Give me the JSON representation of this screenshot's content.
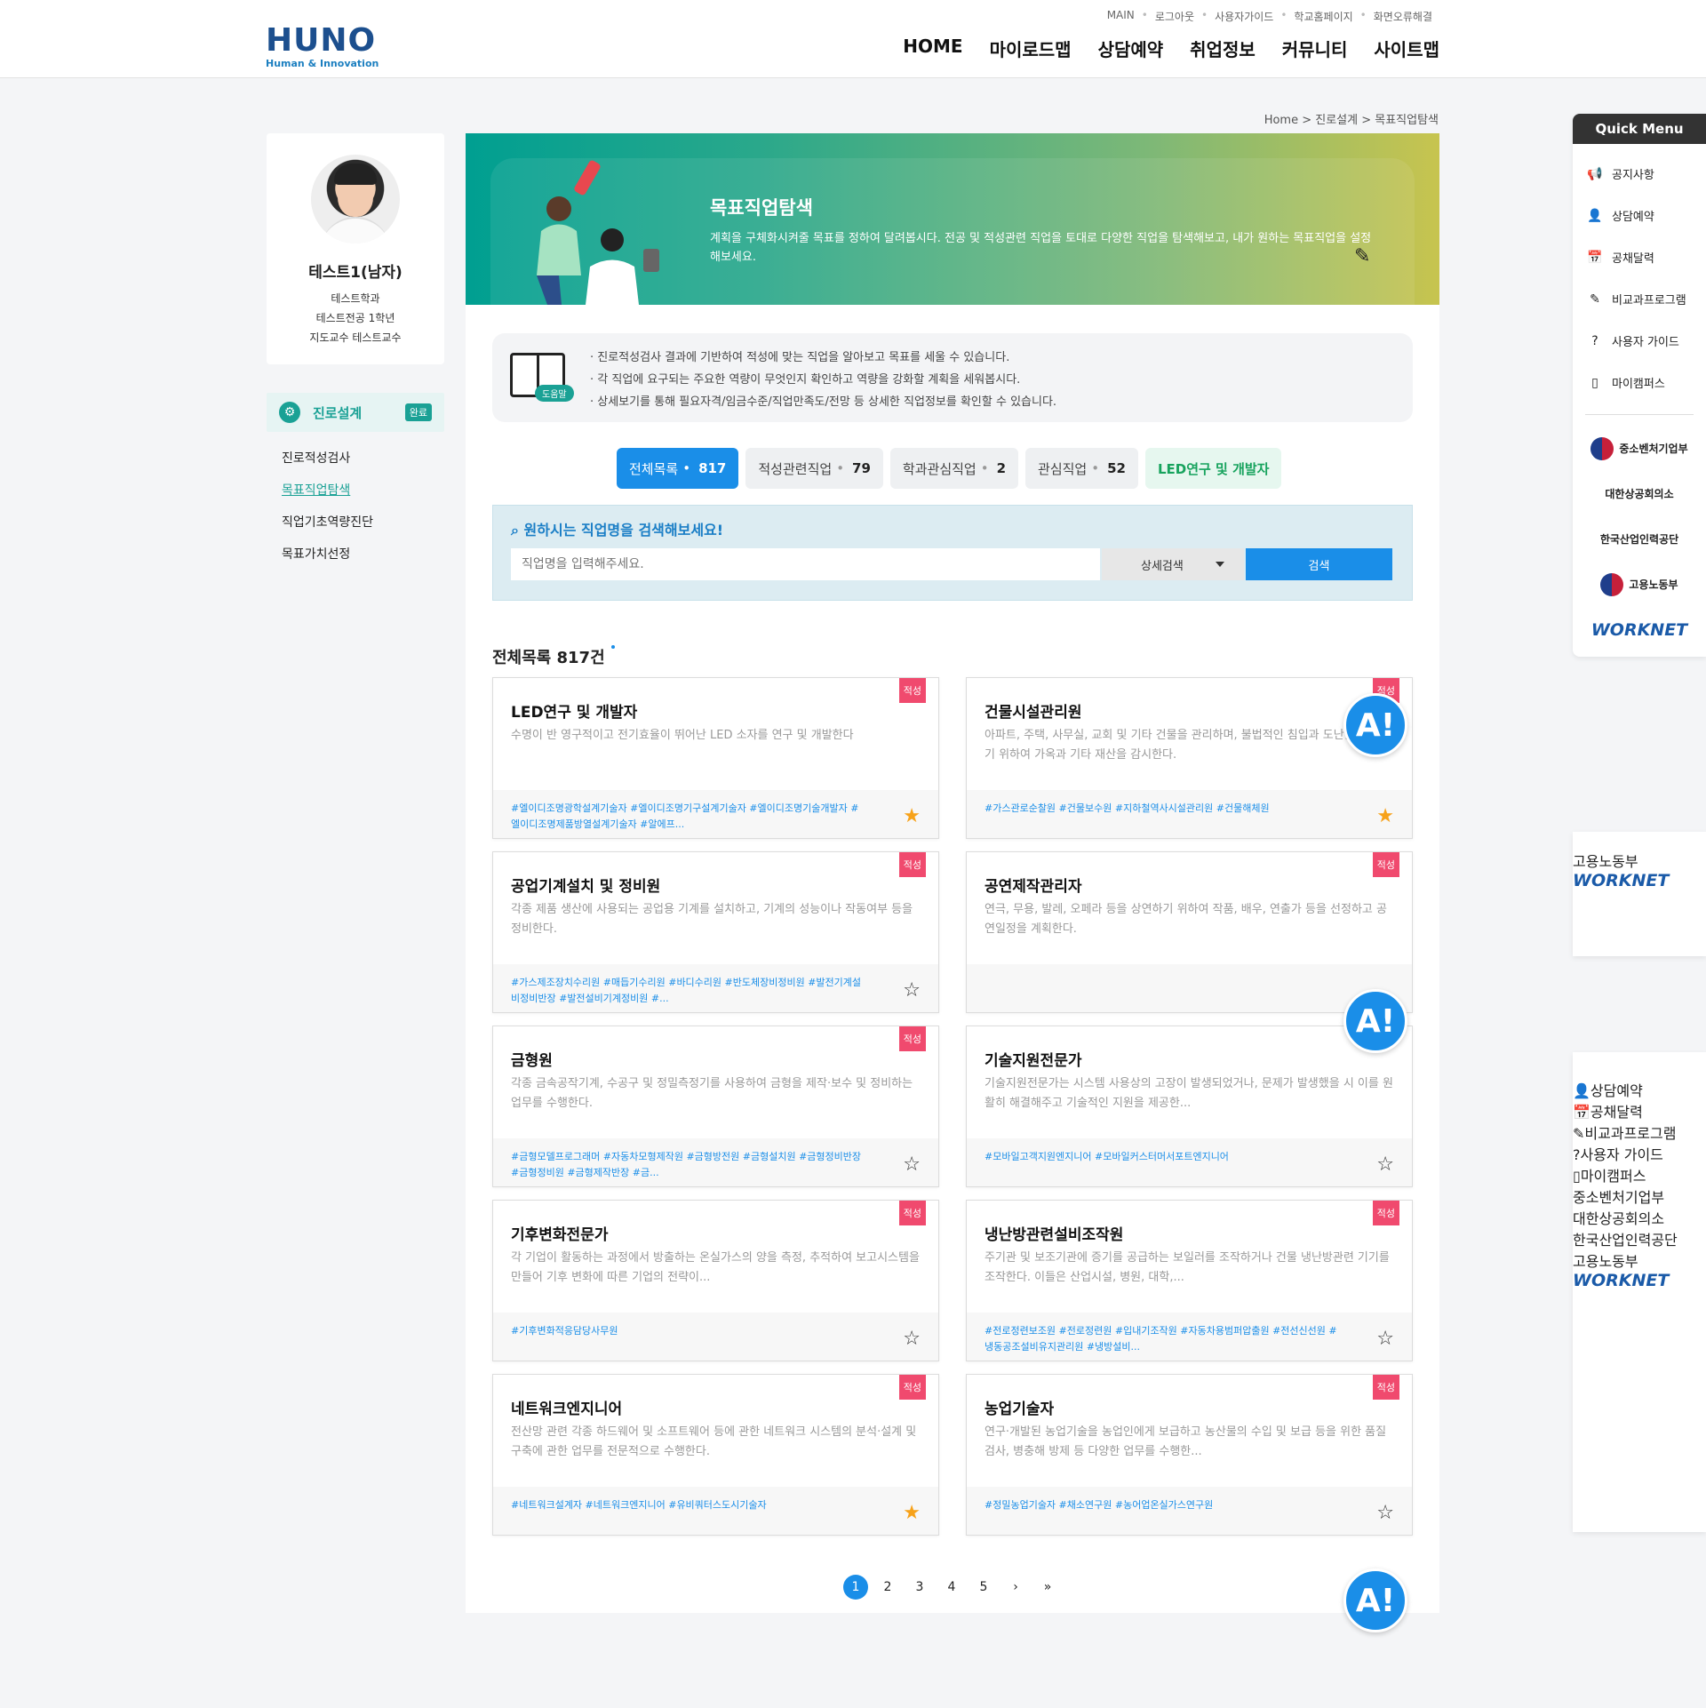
{
  "header": {
    "logo_main": "HUNO",
    "logo_sub": "Human & Innovation",
    "util": [
      "MAIN",
      "로그아웃",
      "사용자가이드",
      "학교홈페이지",
      "화면오류해결"
    ],
    "gnb": [
      "HOME",
      "마이로드맵",
      "상담예약",
      "취업정보",
      "커뮤니티",
      "사이트맵"
    ]
  },
  "breadcrumb": "Home > 진로설계 > 목표직업탐색",
  "profile": {
    "name": "테스트1(남자)",
    "dept": "테스트학과",
    "major": "테스트전공 1학년",
    "advisor": "지도교수 테스트교수"
  },
  "left_menu": {
    "current": "진로설계",
    "badge": "완료",
    "items": [
      "진로적성검사",
      "목표직업탐색",
      "직업기초역량진단",
      "목표가치선정"
    ]
  },
  "hero": {
    "title": "목표직업탐색",
    "desc": "계획을 구체화시켜줄 목표를 정하여 달려봅시다. 전공 및 적성관련 직업을 토대로 다양한 직업을 탐색해보고, 내가 원하는 목표직업을 설정해보세요."
  },
  "guide": {
    "help_label": "도움말",
    "items": [
      "· 진로적성검사 결과에 기반하여 적성에 맞는 직업을 알아보고 목표를 세울 수 있습니다.",
      "· 각 직업에 요구되는 주요한 역량이 무엇인지 확인하고 역량을 강화할 계획을 세워봅시다.",
      "· 상세보기를 통해 필요자격/임금수준/직업만족도/전망 등 상세한 직업정보를 확인할 수 있습니다."
    ]
  },
  "tabs": [
    {
      "label": "전체목록",
      "count": "817"
    },
    {
      "label": "적성관련직업",
      "count": "79"
    },
    {
      "label": "학과관심직업",
      "count": "2"
    },
    {
      "label": "관심직업",
      "count": "52"
    },
    {
      "label": "LED연구 및 개발자",
      "count": ""
    }
  ],
  "search": {
    "label": "원하시는 직업명을 검색해보세요!",
    "placeholder": "직업명을 입력해주세요.",
    "select": "상세검색",
    "button": "검색"
  },
  "list_title": "전체목록 817건",
  "cards": [
    {
      "tag": "적성",
      "title": "LED연구 및 개발자",
      "desc": "수명이 반 영구적이고 전기효율이 뛰어난 LED 소자를 연구 및 개발한다",
      "keywords": "#엘이디조명광학설계기술자 #엘이디조명기구설계기술자 #엘이디조명기술개발자 #엘이디조명제품방열설계기술자 #알에프...",
      "starred": true
    },
    {
      "tag": "적성",
      "title": "건물시설관리원",
      "desc": "아파트, 주택, 사무실, 교회 및 기타 건물을 관리하며, 불법적인 침입과 도난을 방지하기 위하여 가옥과 기타 재산을 감시한다.",
      "keywords": "#가스관로순찰원 #건물보수원 #지하철역사시설관리원 #건물해체원",
      "starred": true
    },
    {
      "tag": "적성",
      "title": "공업기계설치 및 정비원",
      "desc": "각종 제품 생산에 사용되는 공업용 기계를 설치하고, 기계의 성능이나 작동여부 등을 정비한다.",
      "keywords": "#가스제조장치수리원 #매듭기수리원 #바디수리원 #반도체장비정비원 #발전기계설비정비반장 #발전설비기계정비원 #...",
      "starred": false
    },
    {
      "tag": "적성",
      "title": "공연제작관리자",
      "desc": "연극, 무용, 발레, 오페라 등을 상연하기 위하여 작품, 배우, 연출가 등을 선정하고 공연일정을 계획한다.",
      "keywords": "",
      "starred": false
    },
    {
      "tag": "적성",
      "title": "금형원",
      "desc": "각종 금속공작기계, 수공구 및 정밀측정기를 사용하여 금형을 제작·보수 및 정비하는 업무를 수행한다.",
      "keywords": "#금형모델프로그래머 #자동차모형제작원 #금형방전원 #금형설치원 #금형정비반장 #금형정비원 #금형제작반장 #금...",
      "starred": false
    },
    {
      "tag": "",
      "title": "기술지원전문가",
      "desc": "기술지원전문가는 시스템 사용상의 고장이 발생되었거나, 문제가 발생했을 시 이를 원활히 해결해주고 기술적인 지원을 제공한...",
      "keywords": "#모바일고객지원엔지니어 #모바일커스터머서포트엔지니어",
      "starred": false
    },
    {
      "tag": "적성",
      "title": "기후변화전문가",
      "desc": "각 기업이 활동하는 과정에서 방출하는 온실가스의 양을 측정, 추적하여 보고시스템을 만들어 기후 변화에 따른 기업의 전략이...",
      "keywords": "#기후변화적응담당사무원",
      "starred": false
    },
    {
      "tag": "적성",
      "title": "냉난방관련설비조작원",
      "desc": "주기관 및 보조기관에 증기를 공급하는 보일러를 조작하거나 건물 냉난방관련 기기를 조작한다. 이들은 산업시설, 병원, 대학,...",
      "keywords": "#전로정련보조원 #전로정련원 #입내기조작원 #자동차용범퍼압출원 #전선신선원 #냉동공조설비유지관리원 #냉방설비...",
      "starred": false
    },
    {
      "tag": "적성",
      "title": "네트워크엔지니어",
      "desc": "전산망 관련 각종 하드웨어 및 소프트웨어 등에 관한 네트워크 시스템의 분석·설계 및 구축에 관한 업무를 전문적으로 수행한다.",
      "keywords": "#네트워크설계자 #네트워크엔지니어 #유비쿼터스도시기술자",
      "starred": true
    },
    {
      "tag": "적성",
      "title": "농업기술자",
      "desc": "연구·개발된 농업기술을 농업인에게 보급하고 농산물의 수입 및 보급 등을 위한 품질검사, 병충해 방제 등 다양한 업무를 수행한...",
      "keywords": "#정밀농업기술자 #채소연구원 #농어업온실가스연구원",
      "starred": false
    }
  ],
  "ai_label": "A!",
  "pager": [
    "1",
    "2",
    "3",
    "4",
    "5",
    "›",
    "»"
  ],
  "quick_menu": {
    "title": "Quick Menu",
    "items": [
      "공지사항",
      "상담예약",
      "공채달력",
      "비교과프로그램",
      "사용자 가이드",
      "마이캠퍼스"
    ],
    "partners": [
      "중소벤처기업부",
      "대한상공회의소",
      "한국산업인력공단",
      "고용노동부",
      "WORKNET"
    ]
  }
}
